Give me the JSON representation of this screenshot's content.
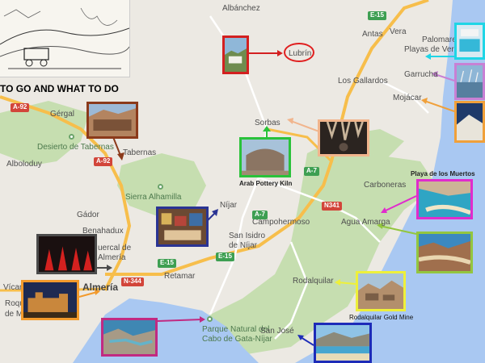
{
  "header": {
    "title": "TO GO AND WHAT TO DO"
  },
  "places": {
    "albanchez": "Albánchez",
    "antas": "Antas",
    "vera": "Vera",
    "palomares": "Palomares",
    "playas_de_vera": "Playas de Vera",
    "lubrin": "Lubrín",
    "los_gallardos": "Los Gallardos",
    "garrucha": "Garrucha",
    "mojacar": "Mojácar",
    "gergal": "Gérgal",
    "sorbas": "Sorbas",
    "desierto": "Desierto de Tabernas",
    "tabernas": "Tabernas",
    "alboloduy": "Alboloduy",
    "carboneras": "Carboneras",
    "sierra_alhamilla": "Sierra Alhamilla",
    "nijar": "Níjar",
    "gador": "Gádor",
    "campohermoso": "Campohermoso",
    "agua_amarga": "Agua Amarga",
    "benahadux": "Benahadux",
    "huercal_1": "uercal de",
    "huercal_2": "Almería",
    "san_isidro_1": "San Isidro",
    "san_isidro_2": "de Níjar",
    "vicar": "Vícar",
    "almeria": "Almería",
    "retamar": "Retamar",
    "rodalquilar": "Rodalquilar",
    "roquetas_1": "Roquetas",
    "roquetas_2": "de Mar",
    "parque_1": "Parque Natural del",
    "parque_2": "Cabo de Gata-Níjar",
    "san_jose": "San José"
  },
  "roads": {
    "e15_top": "E-15",
    "a92_left": "A-92",
    "a92_mid": "A-92",
    "a7_mid": "A-7",
    "a7_low": "A-7",
    "n341": "N341",
    "e15_low": "E-15",
    "e15_right": "E-15",
    "n344": "N-344"
  },
  "annotations": {
    "arab_pottery": "Arab Pottery Kiln",
    "playa_muertos": "Playa de los Muertos",
    "rodalquilar_gold": "Rodalquilar Gold Mine"
  },
  "colors": {
    "land": "#ece9e3",
    "park_green": "#c6deb0",
    "sea": "#a9c8f2",
    "motorway": "#f7be4b",
    "road": "#ffffff",
    "circle": "#e01e1e"
  },
  "photos": [
    {
      "id": "lubrin",
      "icon": "village-photo",
      "color": "#d32020"
    },
    {
      "id": "tabernas",
      "icon": "western-town-photo",
      "color": "#8b3a1b"
    },
    {
      "id": "sorbas",
      "icon": "cave-photo",
      "color": "#f1b58d"
    },
    {
      "id": "pottery",
      "icon": "kiln-photo",
      "color": "#2ac23a"
    },
    {
      "id": "nijar",
      "icon": "market-photo",
      "color": "#2a3494"
    },
    {
      "id": "flamenco",
      "icon": "flamenco-photo",
      "color": "#4b4b4b"
    },
    {
      "id": "alcazaba",
      "icon": "castle-photo",
      "color": "#f29a2c"
    },
    {
      "id": "cabo",
      "icon": "coast-photo",
      "color": "#c12a82"
    },
    {
      "id": "sanjose",
      "icon": "bay-photo",
      "color": "#1d2bb8"
    },
    {
      "id": "gold",
      "icon": "mine-photo",
      "color": "#eef03a"
    },
    {
      "id": "agua",
      "icon": "beach-photo",
      "color": "#93c63f"
    },
    {
      "id": "muertos",
      "icon": "cove-photo",
      "color": "#e02ccc"
    },
    {
      "id": "mojacar",
      "icon": "hill-town-photo",
      "color": "#f0a03a"
    },
    {
      "id": "garrucha",
      "icon": "harbor-photo",
      "color": "#c880d4"
    },
    {
      "id": "vera",
      "icon": "pool-photo",
      "color": "#1fd5e6"
    }
  ]
}
